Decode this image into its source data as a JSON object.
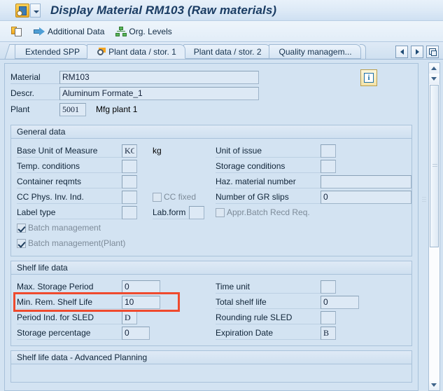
{
  "window": {
    "title": "Display Material RM103 (Raw materials)",
    "menu_icon": "sap-menu-icon",
    "menu_dropdown_icon": "chevron-down-icon"
  },
  "toolbar": {
    "items": [
      {
        "label": "",
        "icon": "clipboard-icon"
      },
      {
        "label": "Additional Data",
        "icon": "right-arrow-icon"
      },
      {
        "label": "Org. Levels",
        "icon": "org-tree-icon"
      }
    ]
  },
  "tabs": {
    "items": [
      {
        "label": "Extended SPP",
        "active": false
      },
      {
        "label": "Plant data / stor. 1",
        "active": true
      },
      {
        "label": "Plant data / stor. 2",
        "active": false
      },
      {
        "label": "Quality managem...",
        "active": false
      }
    ],
    "nav": {
      "prev_icon": "left-arrow-icon",
      "next_icon": "right-arrow-icon",
      "list_icon": "tab-list-icon"
    }
  },
  "header": {
    "material_label": "Material",
    "material_value": "RM103",
    "descr_label": "Descr.",
    "descr_value": "Aluminum Formate_1",
    "plant_label": "Plant",
    "plant_value": "5001",
    "plant_text": "Mfg plant 1",
    "info_button_icon": "info-icon",
    "info_button_glyph": "i"
  },
  "general_data": {
    "title": "General data",
    "base_uom_label": "Base Unit of Measure",
    "base_uom_value": "KG",
    "base_uom_text": "kg",
    "unit_of_issue_label": "Unit of issue",
    "unit_of_issue_value": "",
    "temp_conditions_label": "Temp. conditions",
    "temp_conditions_value": "",
    "storage_conditions_label": "Storage conditions",
    "storage_conditions_value": "",
    "container_reqmts_label": "Container reqmts",
    "container_reqmts_value": "",
    "haz_material_label": "Haz. material number",
    "haz_material_value": "",
    "cc_phys_inv_label": "CC Phys. Inv. Ind.",
    "cc_phys_inv_value": "",
    "cc_fixed_label": "CC fixed",
    "cc_fixed_checked": false,
    "gr_slips_label": "Number of GR slips",
    "gr_slips_value": "0",
    "label_type_label": "Label type",
    "label_type_value": "",
    "lab_form_label": "Lab.form",
    "lab_form_value": "",
    "appr_batch_label": "Appr.Batch Recd Req.",
    "appr_batch_checked": false,
    "batch_mgmt_label": "Batch management",
    "batch_mgmt_checked": true,
    "batch_mgmt_plant_label": "Batch management(Plant)",
    "batch_mgmt_plant_checked": true
  },
  "shelf_life": {
    "title": "Shelf life data",
    "max_storage_label": "Max. Storage Period",
    "max_storage_value": "0",
    "time_unit_label": "Time unit",
    "time_unit_value": "",
    "min_rem_label": "Min. Rem. Shelf Life",
    "min_rem_value": "10",
    "total_shelf_label": "Total shelf life",
    "total_shelf_value": "0",
    "period_ind_label": "Period Ind. for SLED",
    "period_ind_value": "D",
    "rounding_rule_label": "Rounding rule SLED",
    "rounding_rule_value": "",
    "storage_pct_label": "Storage percentage",
    "storage_pct_value": "0",
    "expiration_label": "Expiration Date",
    "expiration_value": "B",
    "highlight_color": "#ef4a2e"
  },
  "shelf_life_adv": {
    "title": "Shelf life data - Advanced Planning"
  }
}
